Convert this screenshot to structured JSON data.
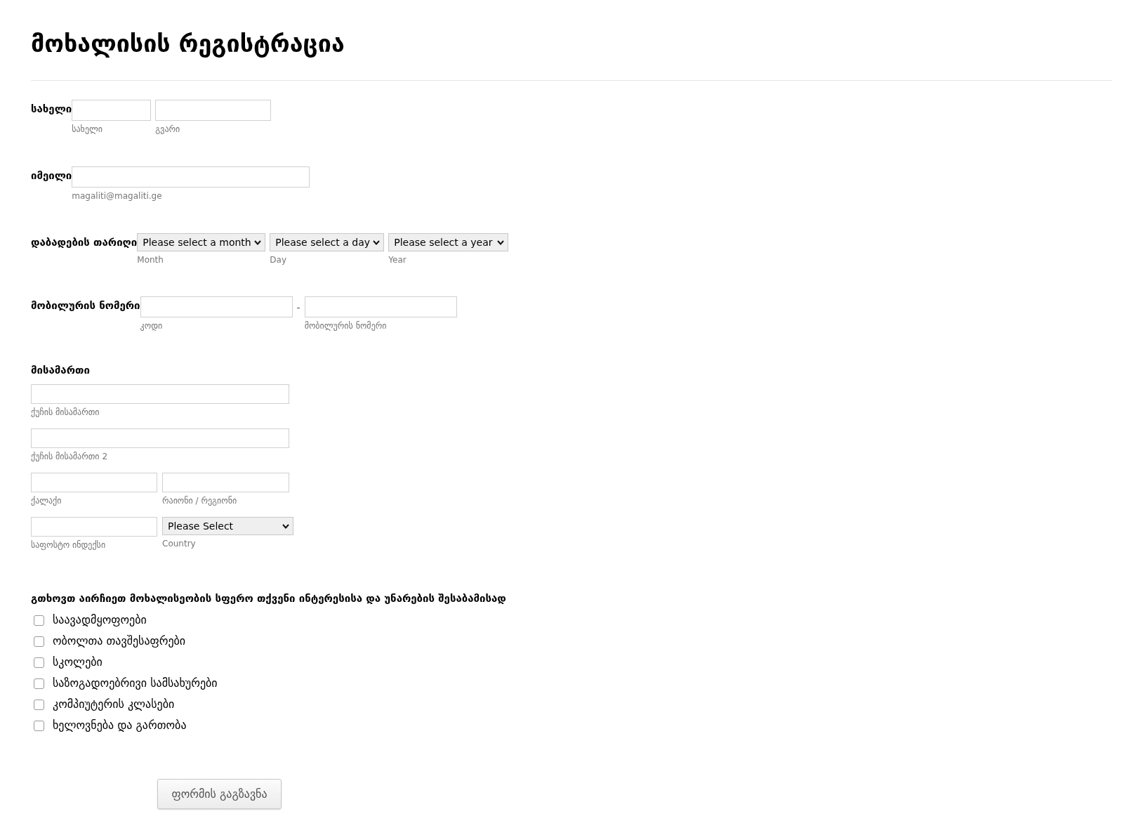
{
  "title": "მოხალისის რეგისტრაცია",
  "form_fields": [
    {
      "kind": "name",
      "label": "სახელი",
      "controls": [
        {
          "kind": "input",
          "sublabel": "სახელი"
        },
        {
          "kind": "input",
          "sublabel": "გვარი"
        }
      ]
    },
    {
      "kind": "email",
      "label": "იმეილი",
      "controls": [
        {
          "kind": "input",
          "sublabel": "magaliti@magaliti.ge"
        }
      ]
    },
    {
      "kind": "date",
      "label": "დაბადების თარიღი",
      "controls": [
        {
          "kind": "select",
          "value": "Please select a month",
          "sublabel": "Month"
        },
        {
          "kind": "select",
          "value": "Please select a day",
          "sublabel": "Day"
        },
        {
          "kind": "select",
          "value": "Please select a year",
          "sublabel": "Year"
        }
      ]
    },
    {
      "kind": "phone",
      "label": "მობილურის ნომერი",
      "controls": [
        {
          "kind": "input",
          "sublabel": "კოდი"
        },
        {
          "kind": "separator",
          "text": "-"
        },
        {
          "kind": "input",
          "sublabel": "მობილურის ნომერი"
        }
      ]
    },
    {
      "kind": "address",
      "label": "მისამართი",
      "rows": [
        {
          "controls": [
            {
              "kind": "input",
              "sublabel": "ქუჩის მისამართი"
            }
          ]
        },
        {
          "controls": [
            {
              "kind": "input",
              "sublabel": "ქუჩის მისამართი 2"
            }
          ]
        },
        {
          "controls": [
            {
              "kind": "input",
              "sublabel": "ქალაქი"
            },
            {
              "kind": "input",
              "sublabel": "რაიონი / რეგიონი"
            }
          ]
        },
        {
          "controls": [
            {
              "kind": "input",
              "sublabel": "საფოსტო ინდექსი"
            },
            {
              "kind": "select",
              "value": "Please Select",
              "sublabel": "Country"
            }
          ]
        }
      ]
    },
    {
      "kind": "checklist",
      "label": "გთხოვთ აირჩიეთ მოხალისეობის სფერო თქვენი ინტერესისა და უნარების შესაბამისად",
      "options": [
        {
          "label": "საავადმყოფოები",
          "checked": false
        },
        {
          "label": "ობოლთა თავშესაფრები",
          "checked": false
        },
        {
          "label": "სკოლები",
          "checked": false
        },
        {
          "label": "საზოგადოებრივი სამსახურები",
          "checked": false
        },
        {
          "label": "კომპიუტერის კლასები",
          "checked": false
        },
        {
          "label": "ხელოვნება და გართობა",
          "checked": false
        }
      ]
    }
  ],
  "submit_button": {
    "label": "ფორმის გაგზავნა"
  }
}
